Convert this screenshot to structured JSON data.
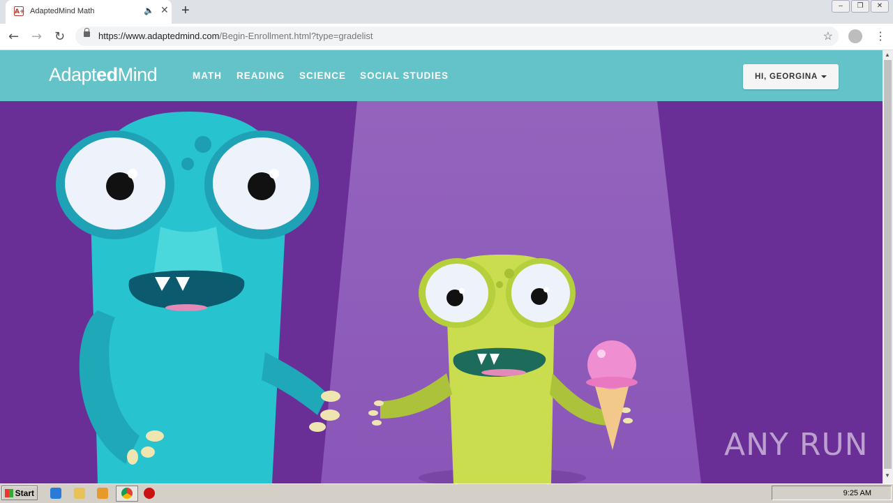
{
  "browser": {
    "tab_title": "AdaptedMind Math",
    "favicon_text": "A+",
    "new_tab_label": "+",
    "url_host": "https://www.adaptedmind.com",
    "url_path": "/Begin-Enrollment.html?type=gradelist"
  },
  "site": {
    "logo_part1": "Adapt",
    "logo_part2": "ed",
    "logo_part3": "Mind",
    "nav": [
      "MATH",
      "READING",
      "SCIENCE",
      "SOCIAL STUDIES"
    ],
    "user_label": "HI, GEORGINA"
  },
  "watermark": "ANY RUN",
  "taskbar": {
    "start_label": "Start",
    "clock": "9:25 AM"
  },
  "colors": {
    "nav_bg": "#63c3c9",
    "hero_bg": "#6a2f96",
    "spotlight": "#9a68c0",
    "blue_monster": "#27c3cf",
    "green_monster": "#c9de4e"
  },
  "icons": [
    "favicon-a-plus-icon",
    "audio-icon",
    "close-icon",
    "back-arrow-icon",
    "forward-arrow-icon",
    "reload-icon",
    "lock-icon",
    "star-icon",
    "profile-icon",
    "kebab-menu-icon",
    "windows-flag-icon",
    "ie-icon",
    "folder-icon",
    "media-icon",
    "chrome-icon",
    "stop-icon"
  ]
}
